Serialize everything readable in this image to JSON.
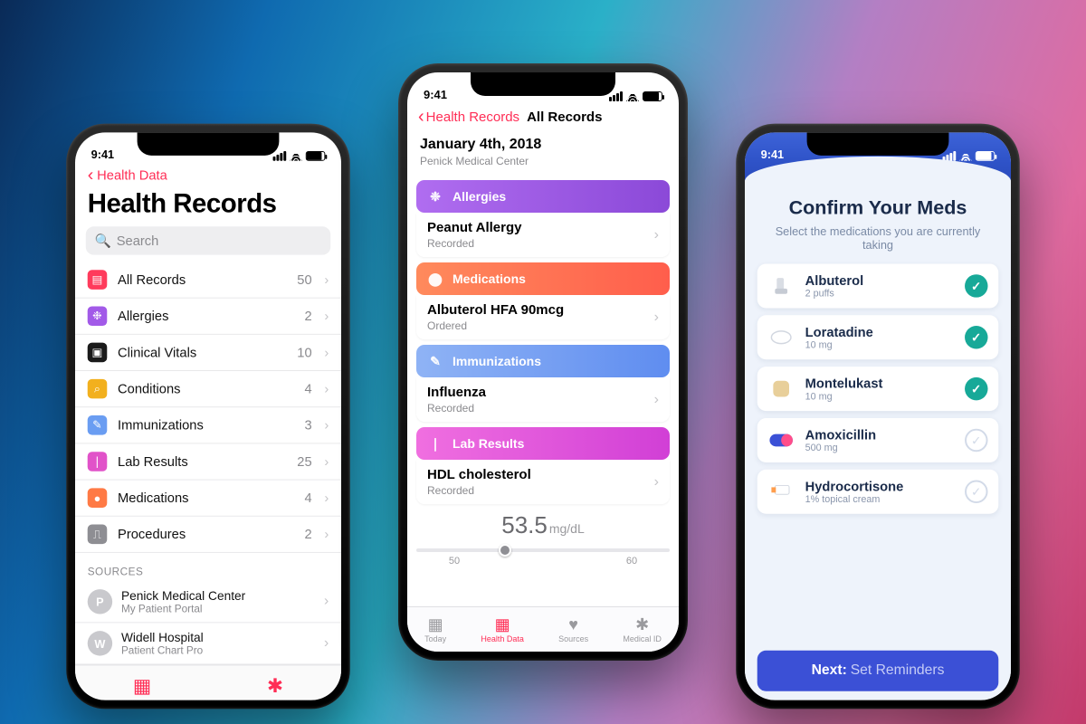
{
  "status_time": "9:41",
  "colors": {
    "pink": "#ff2d55",
    "purple": "#a25ae8",
    "orange": "#ff7a45",
    "blue": "#6a9df2",
    "magenta": "#e152c9",
    "teal": "#17a998",
    "next_btn": "#3b50d6"
  },
  "phone1": {
    "back_label": "Health Data",
    "title": "Health Records",
    "search_placeholder": "Search",
    "categories": [
      {
        "icon": "records-icon",
        "color": "#ff3b5c",
        "label": "All Records",
        "count": 50
      },
      {
        "icon": "allergies-icon",
        "color": "#a25ae8",
        "label": "Allergies",
        "count": 2
      },
      {
        "icon": "vitals-icon",
        "color": "#1a1a1a",
        "label": "Clinical Vitals",
        "count": 10
      },
      {
        "icon": "conditions-icon",
        "color": "#f2b01e",
        "label": "Conditions",
        "count": 4
      },
      {
        "icon": "immunizations-icon",
        "color": "#6a9df2",
        "label": "Immunizations",
        "count": 3
      },
      {
        "icon": "lab-icon",
        "color": "#e152c9",
        "label": "Lab Results",
        "count": 25
      },
      {
        "icon": "medications-icon",
        "color": "#ff7a45",
        "label": "Medications",
        "count": 4
      },
      {
        "icon": "procedures-icon",
        "color": "#8e8e93",
        "label": "Procedures",
        "count": 2
      }
    ],
    "sources_header": "SOURCES",
    "sources": [
      {
        "initial": "P",
        "name": "Penick Medical Center",
        "sub": "My Patient Portal"
      },
      {
        "initial": "W",
        "name": "Widell Hospital",
        "sub": "Patient Chart Pro"
      }
    ]
  },
  "phone2": {
    "back_label": "Health Records",
    "title": "All Records",
    "date": "January 4th, 2018",
    "facility": "Penick Medical Center",
    "sections": [
      {
        "header": "Allergies",
        "color1": "#b06df0",
        "color2": "#8b49d8",
        "icon": "allergies-icon",
        "item": "Peanut Allergy",
        "status": "Recorded"
      },
      {
        "header": "Medications",
        "color1": "#ff8a5c",
        "color2": "#ff5e4c",
        "icon": "medications-icon",
        "item": "Albuterol HFA 90mcg",
        "status": "Ordered"
      },
      {
        "header": "Immunizations",
        "color1": "#8fb3f5",
        "color2": "#5f8df0",
        "icon": "immunizations-icon",
        "item": "Influenza",
        "status": "Recorded"
      },
      {
        "header": "Lab Results",
        "color1": "#f06fe0",
        "color2": "#d13fd6",
        "icon": "lab-icon",
        "item": "HDL cholesterol",
        "status": "Recorded"
      }
    ],
    "lab_value": "53.5",
    "lab_unit": "mg/dL",
    "lab_scale": {
      "min_label": "50",
      "max_label": "60",
      "min": 50,
      "max": 60,
      "value": 53.5
    },
    "tabs": [
      {
        "label": "Today",
        "icon": "calendar-icon"
      },
      {
        "label": "Health Data",
        "icon": "grid-icon",
        "active": true
      },
      {
        "label": "Sources",
        "icon": "heart-icon"
      },
      {
        "label": "Medical ID",
        "icon": "asterisk-icon"
      }
    ]
  },
  "phone3": {
    "title": "Confirm Your Meds",
    "subtitle": "Select the medications you are currently taking",
    "meds": [
      {
        "name": "Albuterol",
        "dose": "2 puffs",
        "checked": true,
        "icon": "inhaler-icon"
      },
      {
        "name": "Loratadine",
        "dose": "10 mg",
        "checked": true,
        "icon": "tablet-icon"
      },
      {
        "name": "Montelukast",
        "dose": "10 mg",
        "checked": true,
        "icon": "square-pill-icon"
      },
      {
        "name": "Amoxicillin",
        "dose": "500 mg",
        "checked": false,
        "icon": "capsule-icon"
      },
      {
        "name": "Hydrocortisone",
        "dose": "1% topical cream",
        "checked": false,
        "icon": "tube-icon"
      }
    ],
    "next_prefix": "Next:",
    "next_label": "Set Reminders"
  }
}
